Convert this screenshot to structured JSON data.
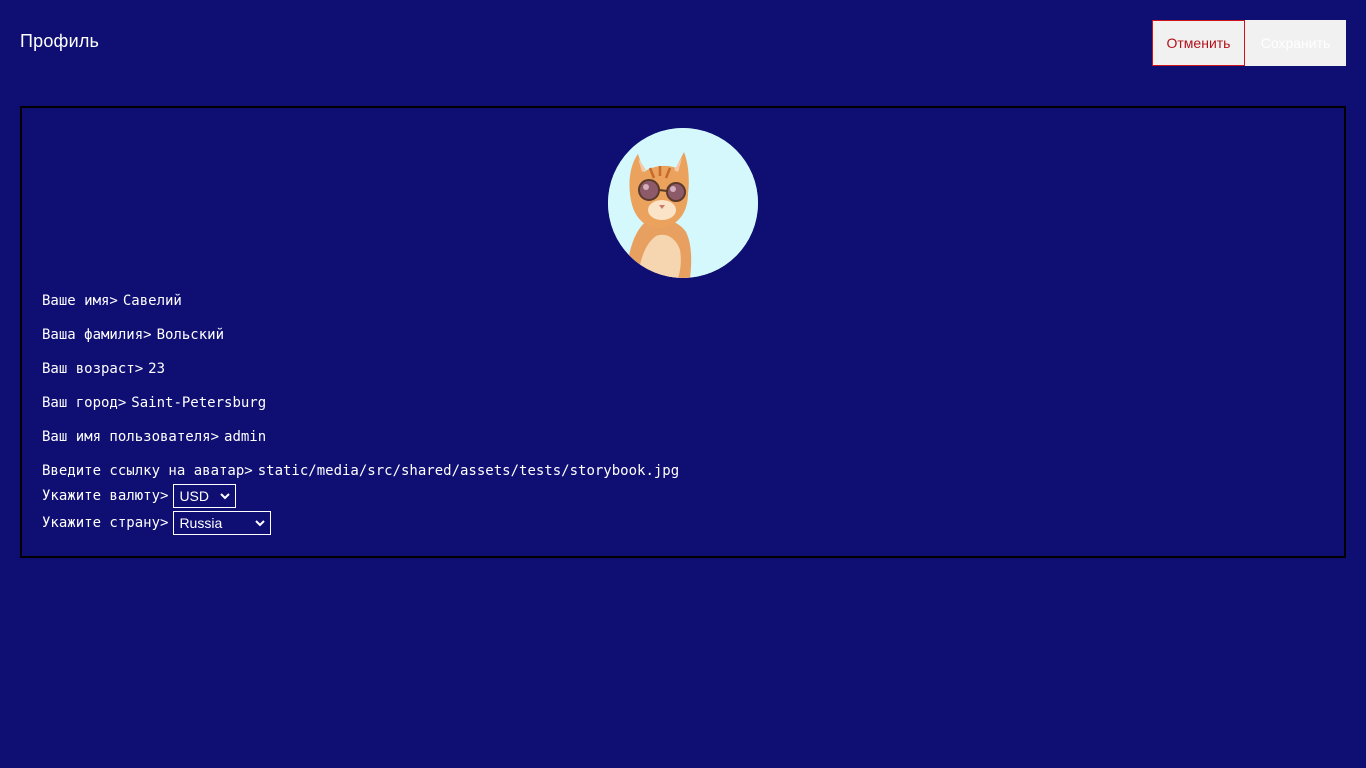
{
  "header": {
    "title": "Профиль",
    "cancel_label": "Отменить",
    "save_label": "Сохранить"
  },
  "avatar": {
    "alt": "cat-with-sunglasses"
  },
  "form": {
    "first_name": {
      "label": "Ваше имя>",
      "value": "Савелий"
    },
    "last_name": {
      "label": "Ваша фамилия>",
      "value": "Вольский"
    },
    "age": {
      "label": "Ваш возраст>",
      "value": "23"
    },
    "city": {
      "label": "Ваш город>",
      "value": "Saint-Petersburg"
    },
    "username": {
      "label": "Ваш имя пользователя>",
      "value": "admin"
    },
    "avatar_link": {
      "label": "Введите ссылку на аватар>",
      "value": "static/media/src/shared/assets/tests/storybook.jpg"
    },
    "currency": {
      "label": "Укажите валюту>",
      "selected": "USD"
    },
    "country": {
      "label": "Укажите страну>",
      "selected": "Russia"
    }
  },
  "colors": {
    "background": "#0e0e73",
    "cancel_border": "#d0141b",
    "cancel_text": "#b1121a",
    "button_bg": "#f1f1f1",
    "avatar_bg": "#d4f8fc"
  }
}
